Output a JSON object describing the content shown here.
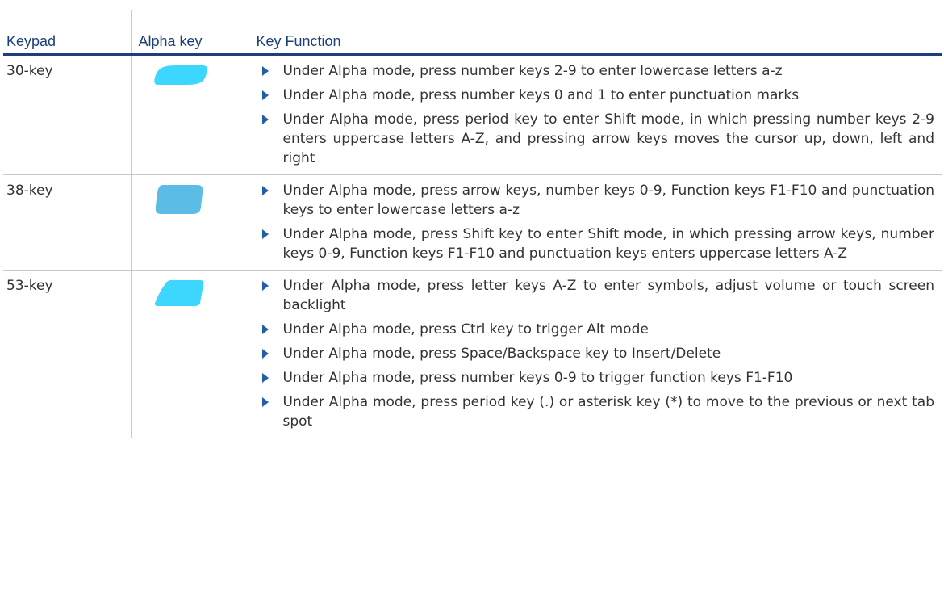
{
  "header": {
    "keypad": "Keypad",
    "alpha_key": "Alpha key",
    "key_function": "Key Function"
  },
  "colors": {
    "header_text": "#1a3f7a",
    "bullet_arrow": "#1f5fa8",
    "key_30": "#3dd6ff",
    "key_38": "#5bbde6",
    "key_53": "#3dd6ff"
  },
  "rows": [
    {
      "keypad": "30-key",
      "alpha_key_icon": "alpha-key-30-icon",
      "functions": [
        "Under Alpha mode, press number keys 2-9 to enter lowercase letters a-z",
        "Under Alpha mode, press number keys 0 and 1 to enter punctuation marks",
        "Under Alpha mode, press period key to enter Shift mode, in which pressing number keys 2-9 enters uppercase letters A-Z, and pressing arrow keys moves the cursor up, down, left and right"
      ]
    },
    {
      "keypad": "38-key",
      "alpha_key_icon": "alpha-key-38-icon",
      "functions": [
        "Under Alpha mode, press arrow keys, number keys 0-9, Function keys F1-F10 and punctuation keys to enter lowercase letters a-z",
        "Under Alpha mode, press Shift key to enter Shift mode, in which pressing arrow keys, number keys 0-9, Function keys F1-F10 and punctuation keys enters uppercase letters A-Z"
      ]
    },
    {
      "keypad": "53-key",
      "alpha_key_icon": "alpha-key-53-icon",
      "functions": [
        "Under Alpha mode, press letter keys A-Z to enter symbols, adjust volume or touch screen backlight",
        "Under Alpha mode, press Ctrl key to trigger Alt mode",
        "Under Alpha mode, press Space/Backspace key to Insert/Delete",
        "Under Alpha mode, press number keys 0-9 to trigger function keys F1-F10",
        "Under Alpha mode, press period key (.) or asterisk key (*) to move to the previous or next tab spot"
      ]
    }
  ]
}
